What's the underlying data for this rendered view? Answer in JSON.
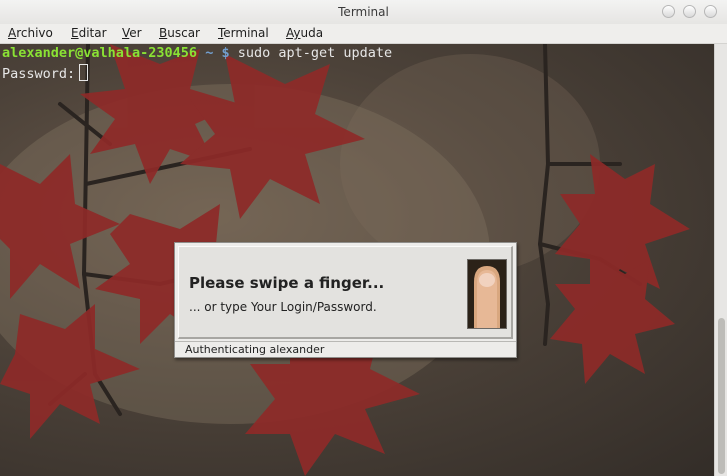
{
  "window": {
    "title": "Terminal",
    "buttons": [
      "minimize",
      "maximize",
      "close"
    ]
  },
  "menu": [
    {
      "accel": "A",
      "rest": "rchivo"
    },
    {
      "accel": "E",
      "rest": "ditar"
    },
    {
      "accel": "V",
      "rest": "er"
    },
    {
      "accel": "B",
      "rest": "uscar"
    },
    {
      "accel": "T",
      "rest": "erminal"
    },
    {
      "accel": "Ay",
      "rest": "uda"
    }
  ],
  "terminal": {
    "prompt_user": "alexander@valhala-230456",
    "prompt_path": " ~ $",
    "command": " sudo apt-get update",
    "password_label": "Password:"
  },
  "dialog": {
    "title": "Please swipe a finger...",
    "subtitle": "... or type Your Login/Password.",
    "status": "Authenticating alexander"
  },
  "colors": {
    "prompt_user": "#8ae234",
    "prompt_path": "#729fcf",
    "leaf": "#8e2a28"
  }
}
